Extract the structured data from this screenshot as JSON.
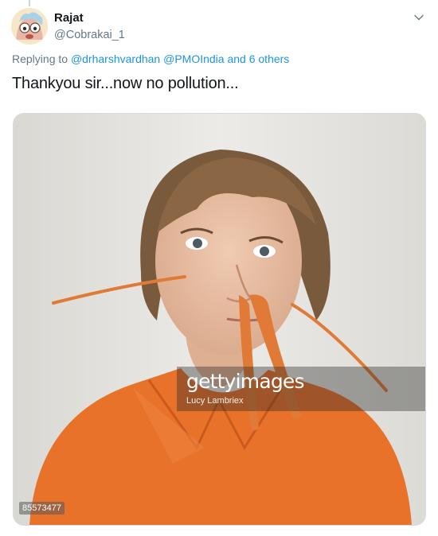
{
  "tweet": {
    "display_name": "Rajat",
    "handle": "@Cobrakai_1",
    "replying_prefix": "Replying to",
    "mention_1": "@drharshvardhan",
    "mention_2": "@PMOIndia",
    "replying_joiner": "and",
    "others": "6 others",
    "text": "Thankyou sir...now no pollution..."
  },
  "media": {
    "watermark_brand": "gettyimages",
    "watermark_credit": "Lucy Lambriex",
    "image_id": "85573477"
  },
  "icons": {
    "caret": "chevron-down-icon",
    "avatar": "avatar-image"
  },
  "colors": {
    "link": "#1b95e0",
    "secondary_text": "#657786",
    "primary_text": "#14171a",
    "shirt": "#e8722a",
    "carrot": "#e07a36"
  }
}
